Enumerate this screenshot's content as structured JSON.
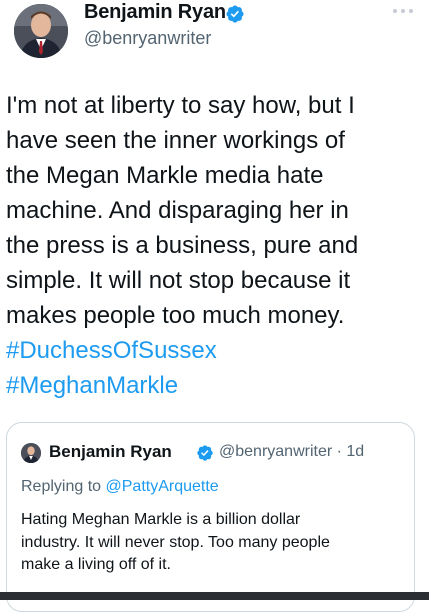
{
  "author": {
    "name": "Benjamin Ryan",
    "handle": "@benryanwriter",
    "verified": true
  },
  "tweet": {
    "lines": [
      "I'm not at liberty to say how, but I",
      "have seen the inner workings of",
      "the Megan Markle media hate",
      "machine. And disparaging her in",
      "the press is a business, pure and",
      "simple. It will not stop because it",
      "makes people too much money."
    ],
    "hashtags": [
      "#DuchessOfSussex",
      "#MeghanMarkle"
    ]
  },
  "quoted": {
    "name": "Benjamin Ryan",
    "handle": "@benryanwriter",
    "separator": "·",
    "time": "1d",
    "reply_prefix": "Replying to",
    "reply_to": "@PattyArquette",
    "lines": [
      "Hating Meghan Markle is a billion dollar",
      "industry. It will never stop. Too many people",
      "make a living off of it."
    ]
  },
  "colors": {
    "accent": "#1d9bf0",
    "secondary_text": "#536471",
    "border": "#cfd9de"
  },
  "icons": [
    "verified-badge-icon",
    "more-options-icon"
  ]
}
